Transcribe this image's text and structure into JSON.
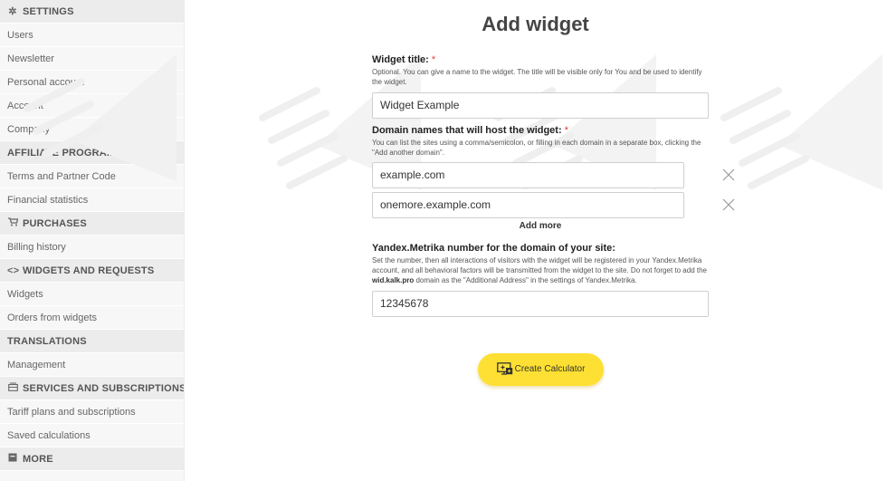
{
  "sidebar": {
    "sections": [
      {
        "title": "SETTINGS",
        "icon": "gear-icon",
        "items": [
          "Users",
          "Newsletter",
          "Personal account",
          "Account",
          "Company"
        ]
      },
      {
        "title": "AFFILIATE PROGRAM",
        "icon": "",
        "items": [
          "Terms and Partner Code",
          "Financial statistics"
        ]
      },
      {
        "title": "PURCHASES",
        "icon": "cart-icon",
        "items": [
          "Billing history"
        ]
      },
      {
        "title": "WIDGETS AND REQUESTS",
        "icon": "code-icon",
        "items": [
          "Widgets",
          "Orders from widgets"
        ]
      },
      {
        "title": "TRANSLATIONS",
        "icon": "",
        "items": [
          "Management"
        ]
      },
      {
        "title": "SERVICES AND SUBSCRIPTIONS",
        "icon": "subscriptions-icon",
        "items": [
          "Tariff plans and subscriptions",
          "Saved calculations"
        ]
      },
      {
        "title": "MORE",
        "icon": "more-icon",
        "items": []
      }
    ]
  },
  "main": {
    "title": "Add widget",
    "widget_title": {
      "label": "Widget title:",
      "required_mark": "*",
      "hint": "Optional. You can give a name to the widget. The title will be visible only for You and be used to identify the widget.",
      "value": "Widget Example"
    },
    "domains": {
      "label": "Domain names that will host the widget:",
      "required_mark": "*",
      "hint": "You can list the sites using a comma/semicolon, or filling in each domain in a separate box, clicking the \"Add another domain\".",
      "values": [
        "example.com",
        "onemore.example.com"
      ],
      "add_more": "Add more"
    },
    "metrika": {
      "label": "Yandex.Metrika number for the domain of your site:",
      "hint_before": "Set the number, then all interactions of visitors with the widget will be registered in your Yandex.Metrika account, and all behavioral factors will be transmitted from the widget to the site. Do not forget to add the ",
      "hint_bold": "wid.kalk.pro",
      "hint_after": " domain as the \"Additional Address\" in the settings of Yandex.Metrika.",
      "value": "12345678"
    },
    "create_button": "Create Calculator"
  },
  "colors": {
    "accent_button": "#fde033",
    "required": "#e53935",
    "sidebar_bg": "#f7f7f7",
    "sidebar_header_bg": "#ececec"
  }
}
